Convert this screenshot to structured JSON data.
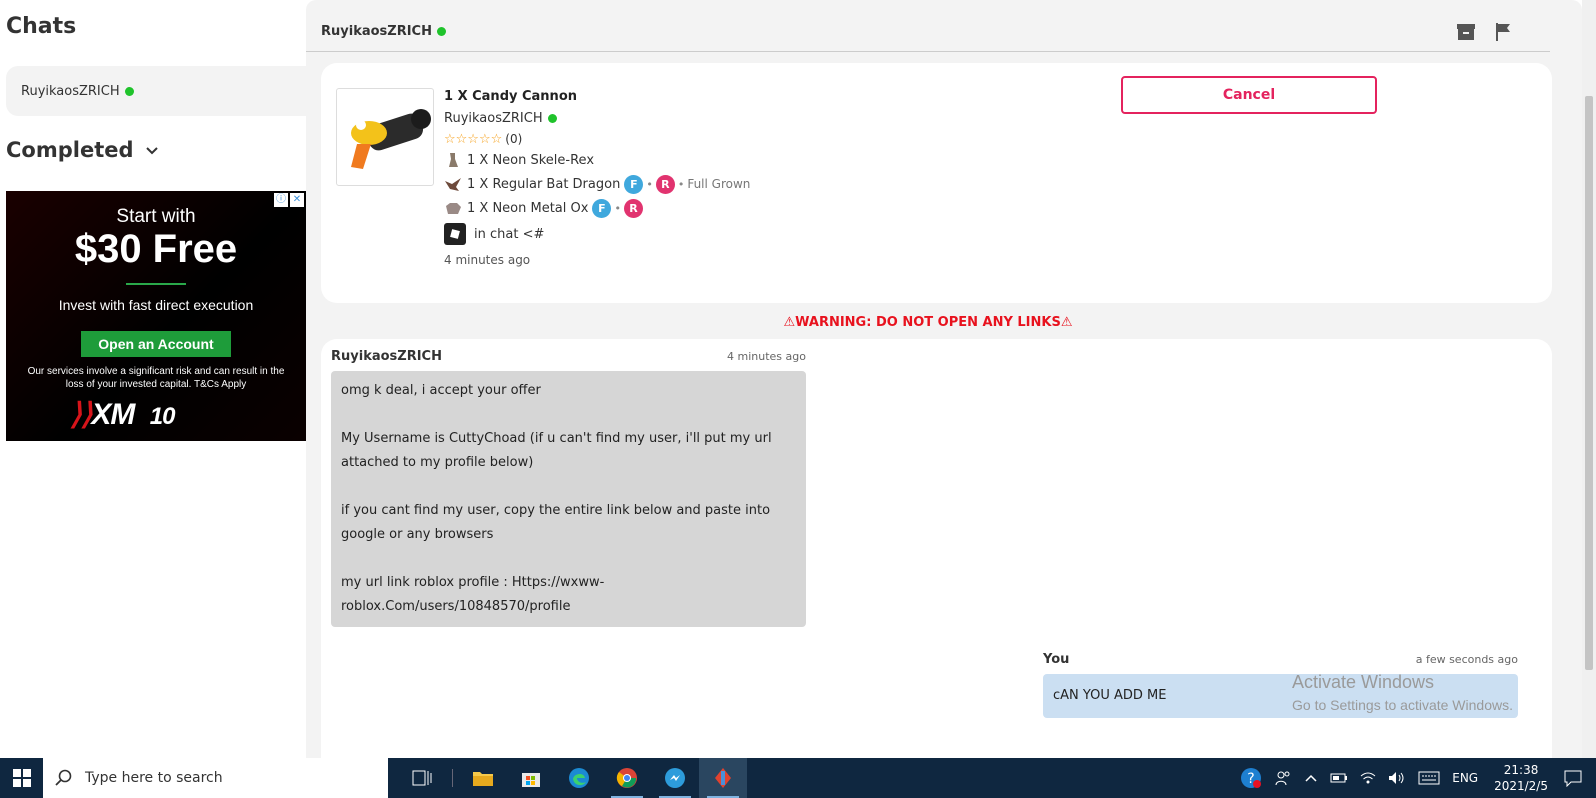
{
  "sidebar": {
    "title": "Chats",
    "chat_item": "RuyikaosZRICH",
    "completed_label": "Completed"
  },
  "ad": {
    "line1": "Start with",
    "line2": "$30 Free",
    "line3": "Invest with fast direct execution",
    "button": "Open an Account",
    "disclaimer": "Our services involve a significant risk and can result in the loss of your invested capital. T&Cs Apply",
    "logo_main": "XM",
    "logo_sub": "10"
  },
  "header": {
    "username": "RuyikaosZRICH"
  },
  "trade": {
    "title": "1 X Candy Cannon",
    "user": "RuyikaosZRICH",
    "rating": "(0)",
    "items": [
      {
        "label": "1 X Neon Skele-Rex"
      },
      {
        "label": "1 X Regular Bat Dragon",
        "badge_f": "F",
        "badge_r": "R",
        "extra": "Full Grown"
      },
      {
        "label": "1 X Neon Metal Ox",
        "badge_f": "F",
        "badge_r": "R"
      }
    ],
    "robux_text": "in chat <#",
    "time": "4 minutes ago",
    "cancel_label": "Cancel"
  },
  "warning": "⚠WARNING: DO NOT OPEN ANY LINKS⚠",
  "messages": {
    "them": {
      "author": "RuyikaosZRICH",
      "time": "4 minutes ago",
      "text": "omg k deal, i accept your offer\n\nMy Username is CuttyChoad (if u can't find my user, i'll put my url attached to my profile below)\n\nif you cant find my user, copy the entire link below and paste into google or any browsers\n\nmy url link roblox profile : Https://wxww-roblox.Com/users/10848570/profile"
    },
    "me": {
      "author": "You",
      "time": "a few seconds ago",
      "text": "cAN YOU ADD ME"
    }
  },
  "activate": {
    "line1": "Activate Windows",
    "line2": "Go to Settings to activate Windows."
  },
  "taskbar": {
    "search_placeholder": "Type here to search",
    "lang": "ENG",
    "time": "21:38",
    "date": "2021/2/5"
  },
  "colors": {
    "online": "#1fc32b",
    "accent": "#e4235e",
    "warning": "#e8121e",
    "taskbar": "#0f2740"
  }
}
